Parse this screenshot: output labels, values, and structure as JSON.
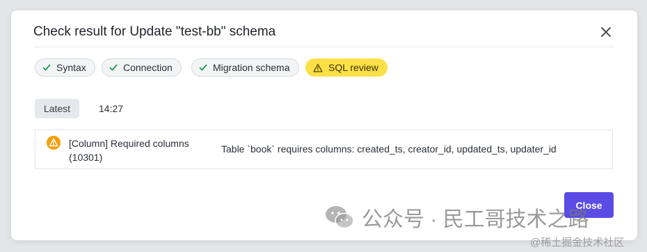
{
  "modal": {
    "title": "Check result for Update \"test-bb\" schema"
  },
  "checks": [
    {
      "label": "Syntax",
      "status": "success"
    },
    {
      "label": "Connection",
      "status": "success"
    },
    {
      "label": "Migration schema",
      "status": "success"
    },
    {
      "label": "SQL review",
      "status": "warning"
    }
  ],
  "result": {
    "tab_label": "Latest",
    "time": "14:27",
    "rule_title": "[Column] Required columns (10301)",
    "message": "Table `book` requires columns: created_ts, creator_id, updated_ts, updater_id"
  },
  "footer": {
    "close_label": "Close"
  },
  "watermark": {
    "text": "公众号 · 民工哥技术之路",
    "site": "@稀土掘金技术社区"
  },
  "colors": {
    "accent": "#5b4ce6",
    "warning": "#f59e0b",
    "warning_chip": "#fde047",
    "success": "#1f9d55"
  },
  "icons": {
    "check": "check-icon",
    "warning": "warning-triangle-icon",
    "close": "close-icon"
  }
}
